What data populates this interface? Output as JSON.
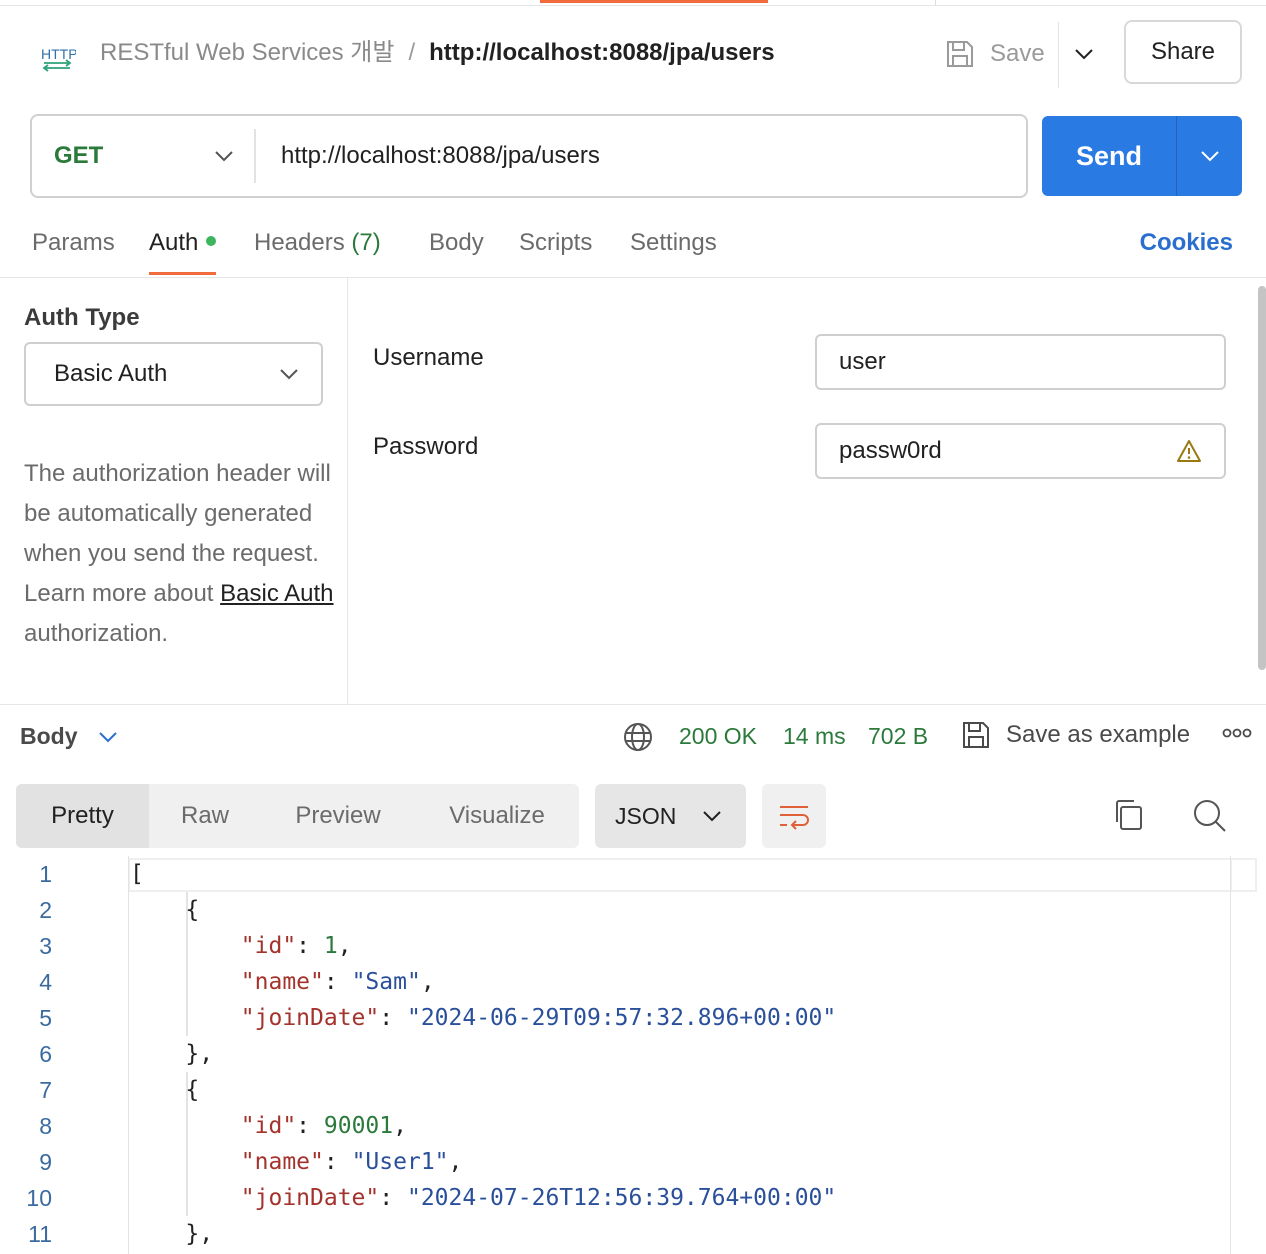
{
  "header": {
    "collection": "RESTful Web Services 개발",
    "separator": "/",
    "request_name": "http://localhost:8088/jpa/users",
    "save_label": "Save",
    "share_label": "Share",
    "icons": {
      "request": "http-icon",
      "save": "save-icon"
    }
  },
  "request": {
    "method": "GET",
    "url": "http://localhost:8088/jpa/users",
    "send_label": "Send"
  },
  "tabs": {
    "params": "Params",
    "auth": "Auth",
    "headers": "Headers",
    "headers_count": "(7)",
    "body": "Body",
    "scripts": "Scripts",
    "settings": "Settings",
    "cookies": "Cookies"
  },
  "auth": {
    "type_label": "Auth Type",
    "type_value": "Basic Auth",
    "desc_part1": "The authorization header will be automatically generated when you send the request. Learn more about ",
    "desc_link": "Basic Auth",
    "desc_part2": "authorization.",
    "username_label": "Username",
    "username_value": "user",
    "password_label": "Password",
    "password_value": "passw0rd"
  },
  "response": {
    "body_label": "Body",
    "status": "200 OK",
    "time": "14 ms",
    "size": "702 B",
    "save_example": "Save as example",
    "views": [
      "Pretty",
      "Raw",
      "Preview",
      "Visualize"
    ],
    "format": "JSON"
  },
  "code_lines": [
    "[",
    "    {",
    "        \"id\": 1,",
    "        \"name\": \"Sam\",",
    "        \"joinDate\": \"2024-06-29T09:57:32.896+00:00\"",
    "    },",
    "    {",
    "        \"id\": 90001,",
    "        \"name\": \"User1\",",
    "        \"joinDate\": \"2024-07-26T12:56:39.764+00:00\"",
    "    },"
  ],
  "colors": {
    "accent": "#f26b3a",
    "send": "#2a7ae4",
    "method_get": "#2b7a3b",
    "status_ok": "#2b7a3b",
    "cookies": "#2a6fd0",
    "json_key": "#a3332c",
    "json_string": "#2a4f9b",
    "json_number": "#2b7a3b"
  }
}
